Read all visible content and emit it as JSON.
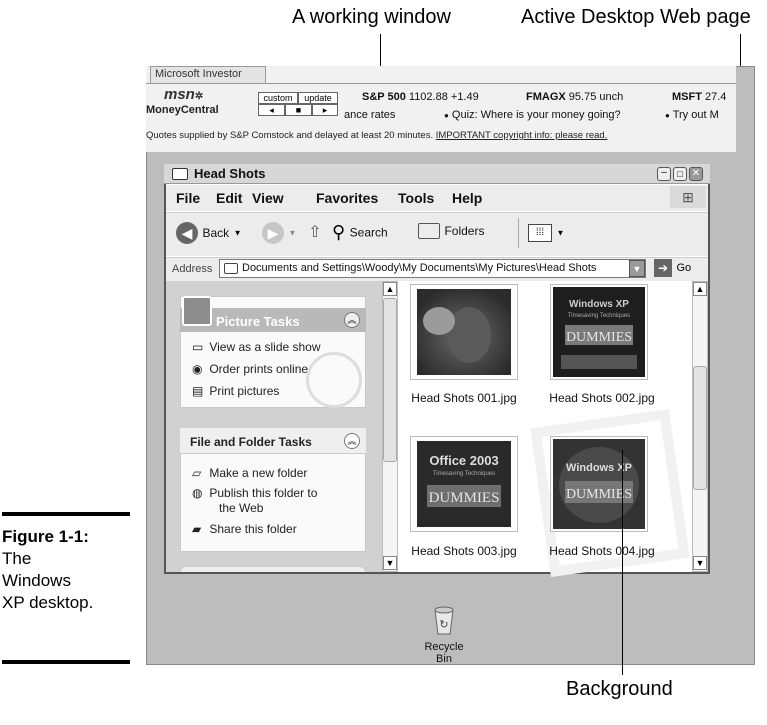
{
  "callouts": {
    "working_window": "A working window",
    "active_desktop": "Active Desktop Web page",
    "background": "Background"
  },
  "figure": {
    "label": "Figure 1-1:",
    "caption_line1": "The",
    "caption_line2": "Windows",
    "caption_line3": "XP desktop."
  },
  "active_desktop": {
    "tab_label": "Microsoft Investor",
    "logo_top": "msn",
    "logo_bottom": "MoneyCentral",
    "custom_label": "custom",
    "update_label": "update",
    "nav_prev": "◂",
    "nav_stop": "■",
    "nav_next": "▸",
    "ticker_row1": [
      {
        "sym": "S&P 500",
        "val": "1102.88 +1.49"
      },
      {
        "sym": "FMAGX",
        "val": "95.75 unch"
      },
      {
        "sym": "MSFT",
        "val": "27.4"
      }
    ],
    "ticker_row2": {
      "left": "ance rates",
      "mid": "Quiz: Where is your money going?",
      "right": "Try out M"
    },
    "quotes_text": "Quotes supplied by S&P Comstock and delayed at least 20 minutes.",
    "quotes_link": "IMPORTANT copyright info: please read."
  },
  "window": {
    "title": "Head Shots",
    "menus": [
      "File",
      "Edit",
      "View",
      "Favorites",
      "Tools",
      "Help"
    ],
    "toolbar": {
      "back": "Back",
      "search": "Search",
      "folders": "Folders"
    },
    "address_label": "Address",
    "address_value": "Documents and Settings\\Woody\\My Documents\\My Pictures\\Head Shots",
    "go_label": "Go",
    "picture_tasks": {
      "title": "Picture Tasks",
      "items": [
        "View as a slide show",
        "Order prints online",
        "Print pictures"
      ]
    },
    "file_tasks": {
      "title": "File and Folder Tasks",
      "items": [
        "Make a new folder",
        "Publish this folder to",
        "the Web",
        "Share this folder"
      ]
    },
    "files": [
      {
        "name": "Head Shots 001.jpg"
      },
      {
        "name": "Head Shots 002.jpg",
        "t1": "Windows XP",
        "t2": "Timesaving Techniques",
        "t3": "DUMMIES"
      },
      {
        "name": "Head Shots 003.jpg",
        "t1": "Office 2003",
        "t2": "Timesaving Techniques",
        "t3": "DUMMIES"
      },
      {
        "name": "Head Shots 004.jpg",
        "t1": "Windows XP",
        "t2": "",
        "t3": "DUMMIES"
      }
    ]
  },
  "desktop": {
    "recycle_bin": "Recycle Bin"
  }
}
